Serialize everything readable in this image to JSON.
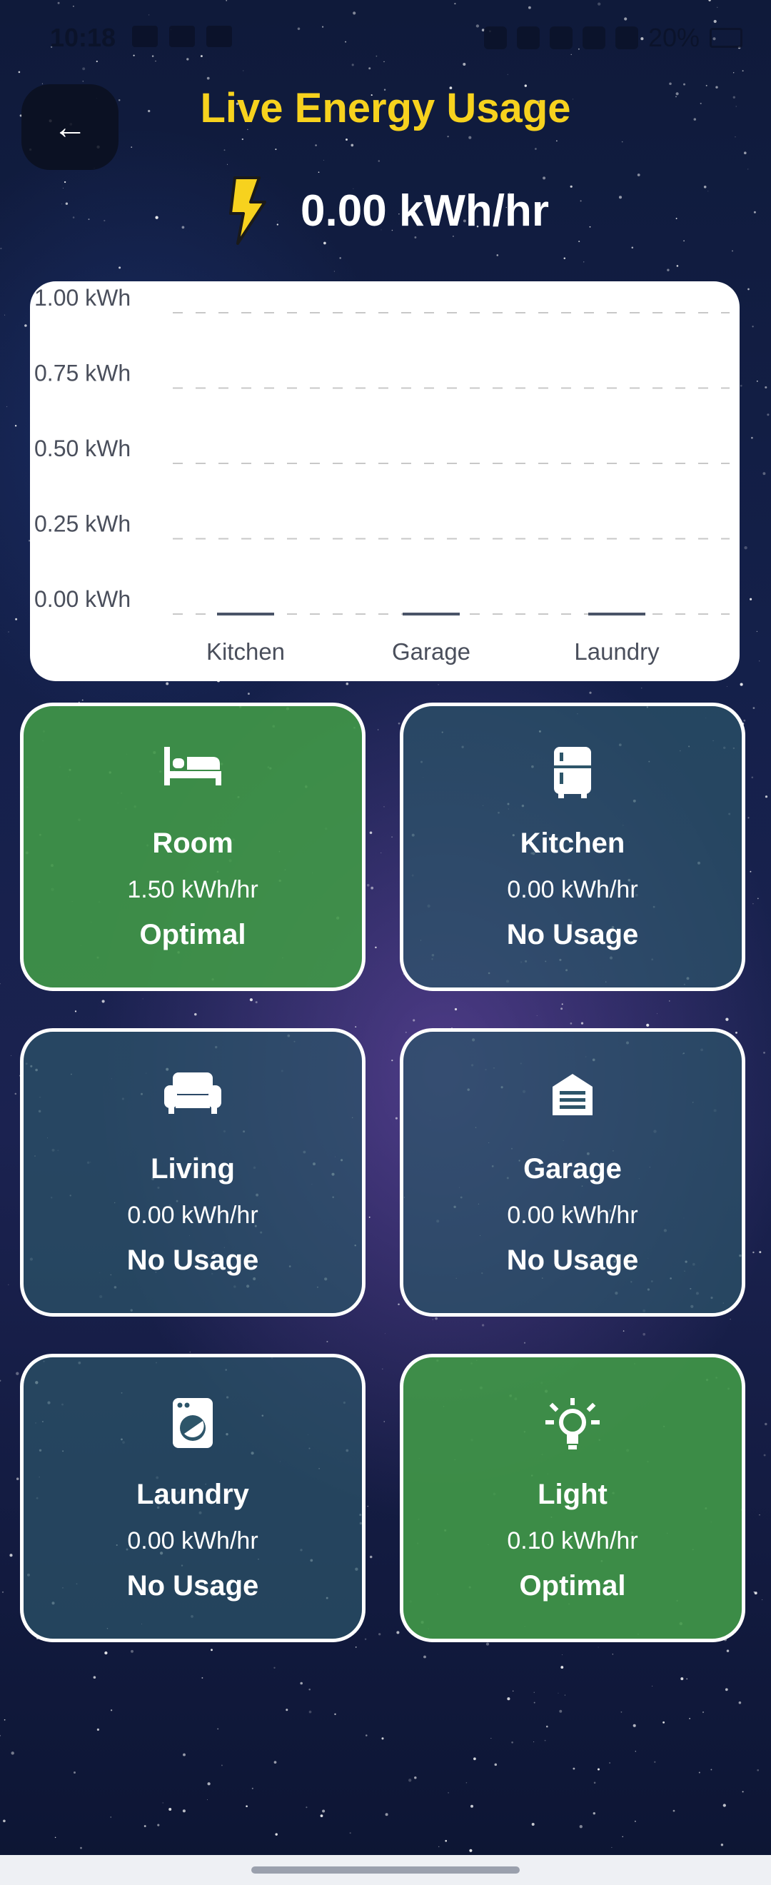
{
  "status_bar": {
    "time": "10:18",
    "battery": "20%"
  },
  "header": {
    "back_label": "←",
    "title": "Live Energy Usage"
  },
  "summary": {
    "total": "0.00 kWh/hr",
    "icon": "lightning-bolt-icon",
    "accent": "#f7d21e"
  },
  "chart_data": {
    "type": "bar",
    "categories": [
      "Kitchen",
      "Garage",
      "Laundry"
    ],
    "values": [
      0.0,
      0.0,
      0.0
    ],
    "ylim": [
      0,
      1.0
    ],
    "yticks": [
      "0.00 kWh",
      "0.25 kWh",
      "0.50 kWh",
      "0.75 kWh",
      "1.00 kWh"
    ],
    "ytick_values": [
      0,
      0.25,
      0.5,
      0.75,
      1.0
    ],
    "grid": true,
    "bar_color": "#4a5468",
    "title": "",
    "xlabel": "",
    "ylabel": ""
  },
  "tiles": [
    {
      "name": "Room",
      "value": "1.50 kWh/hr",
      "status": "Optimal",
      "state": "optimal",
      "icon": "bed-icon"
    },
    {
      "name": "Kitchen",
      "value": "0.00 kWh/hr",
      "status": "No Usage",
      "state": "none",
      "icon": "fridge-icon"
    },
    {
      "name": "Living",
      "value": "0.00 kWh/hr",
      "status": "No Usage",
      "state": "none",
      "icon": "sofa-icon"
    },
    {
      "name": "Garage",
      "value": "0.00 kWh/hr",
      "status": "No Usage",
      "state": "none",
      "icon": "garage-icon"
    },
    {
      "name": "Laundry",
      "value": "0.00 kWh/hr",
      "status": "No Usage",
      "state": "none",
      "icon": "washing-machine-icon"
    },
    {
      "name": "Light",
      "value": "0.10 kWh/hr",
      "status": "Optimal",
      "state": "optimal",
      "icon": "lightbulb-icon"
    }
  ],
  "colors": {
    "optimal": "#409648",
    "no_usage": "#2d5569",
    "title": "#f7d21e"
  }
}
